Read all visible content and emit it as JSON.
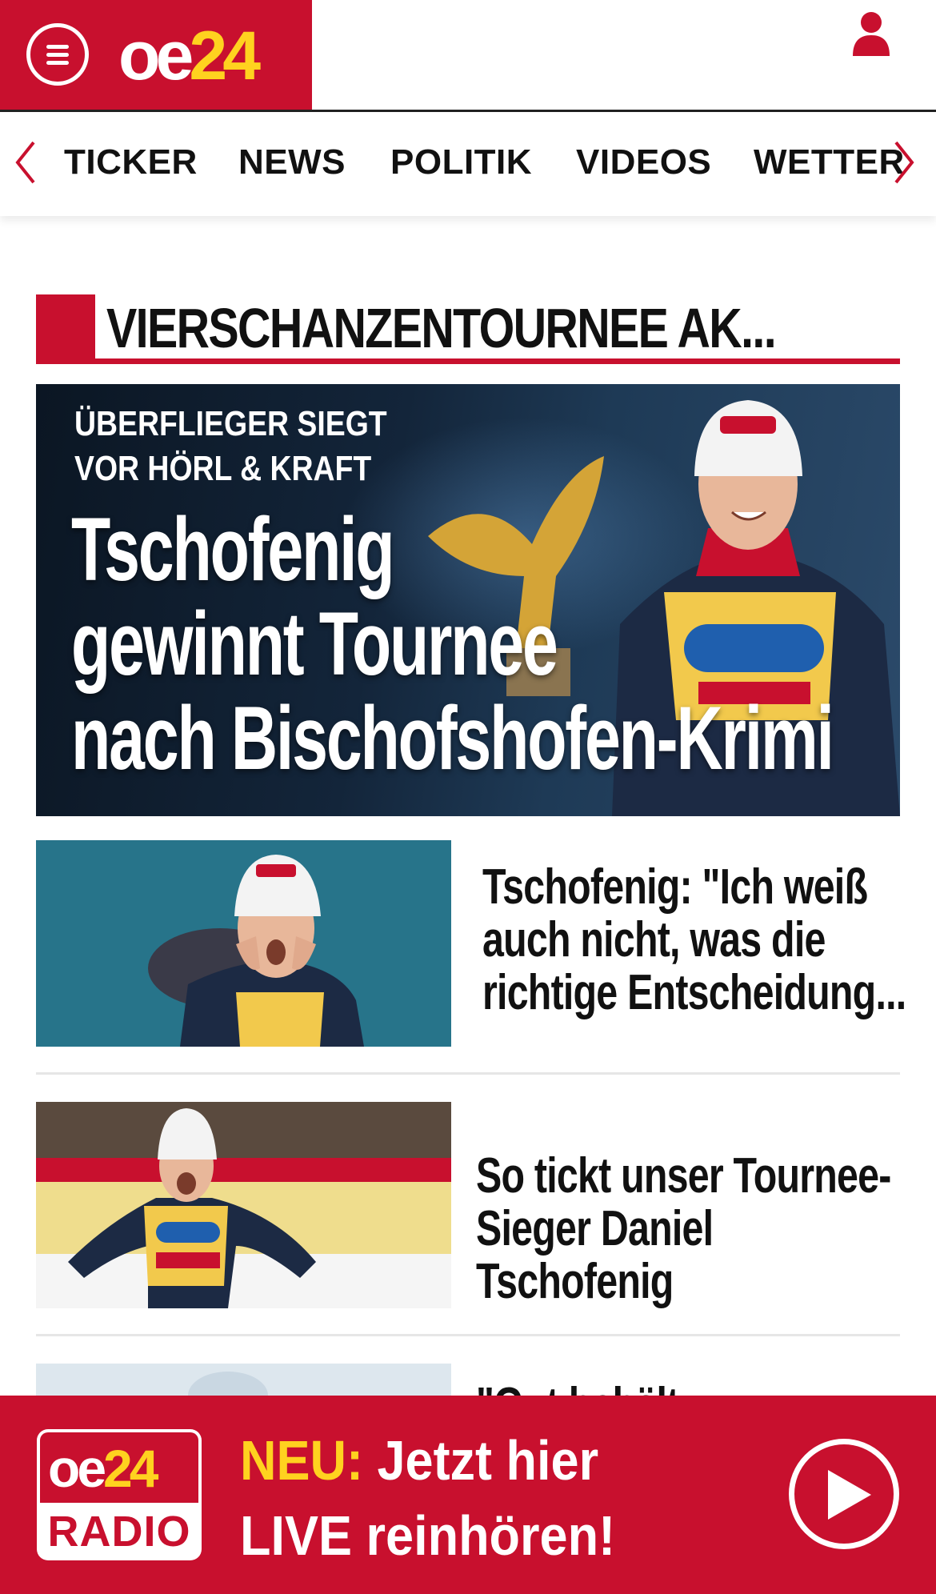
{
  "header": {
    "logo_oe": "oe",
    "logo_24": "24",
    "menu_icon": "hamburger-menu-icon",
    "user_icon": "user-icon"
  },
  "nav": {
    "items": [
      "TICKER",
      "NEWS",
      "POLITIK",
      "VIDEOS",
      "WETTER"
    ],
    "prev_icon": "chevron-left-icon",
    "next_icon": "chevron-right-icon"
  },
  "section": {
    "title": "VIERSCHANZENTOURNEE AK..."
  },
  "hero": {
    "kicker_line1": "ÜBERFLIEGER SIEGT",
    "kicker_line2": "VOR HÖRL & KRAFT",
    "headline_line1": "Tschofenig",
    "headline_line2": "gewinnt Tournee",
    "headline_line3": "nach Bischofshofen-Krimi"
  },
  "articles": [
    {
      "title": "Tschofenig: \"Ich weiß auch nicht, was die richtige Entscheidung..."
    },
    {
      "title": "So tickt unser Tournee-Sieger Daniel Tschofenig"
    },
    {
      "title": "\"Gut behält..."
    }
  ],
  "radio": {
    "logo_oe": "oe",
    "logo_24": "24",
    "logo_radio": "RADIO",
    "neu": "NEU:",
    "line1_rest": " Jetzt hier",
    "line2": "LIVE reinhören!",
    "play_icon": "play-icon"
  },
  "colors": {
    "brand_red": "#c8102e",
    "brand_yellow": "#ffd21f"
  }
}
